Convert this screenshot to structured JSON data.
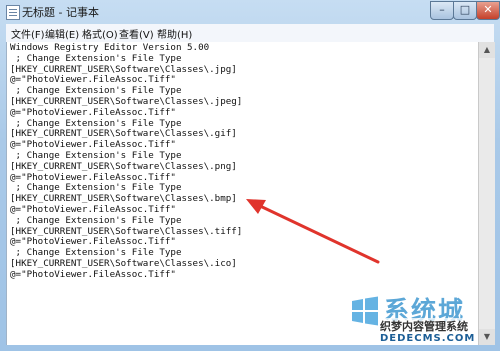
{
  "window": {
    "title": "无标题 - 记事本",
    "controls": {
      "minimize": "–",
      "maximize": "□",
      "close": "✕"
    }
  },
  "menu": [
    "文件(F)",
    "编辑(E)",
    "格式(O)",
    "查看(V)",
    "帮助(H)"
  ],
  "document": {
    "lines": [
      "Windows Registry Editor Version 5.00",
      "; Change Extension's File Type",
      "[HKEY_CURRENT_USER\\Software\\Classes\\.jpg]",
      "@=\"PhotoViewer.FileAssoc.Tiff\"",
      "; Change Extension's File Type",
      "[HKEY_CURRENT_USER\\Software\\Classes\\.jpeg]",
      "@=\"PhotoViewer.FileAssoc.Tiff\"",
      "; Change Extension's File Type",
      "[HKEY_CURRENT_USER\\Software\\Classes\\.gif]",
      "@=\"PhotoViewer.FileAssoc.Tiff\"",
      "; Change Extension's File Type",
      "[HKEY_CURRENT_USER\\Software\\Classes\\.png]",
      "@=\"PhotoViewer.FileAssoc.Tiff\"",
      "; Change Extension's File Type",
      "[HKEY_CURRENT_USER\\Software\\Classes\\.bmp]",
      "@=\"PhotoViewer.FileAssoc.Tiff\"",
      "; Change Extension's File Type",
      "[HKEY_CURRENT_USER\\Software\\Classes\\.tiff]",
      "@=\"PhotoViewer.FileAssoc.Tiff\"",
      "; Change Extension's File Type",
      "[HKEY_CURRENT_USER\\Software\\Classes\\.ico]",
      "@=\"PhotoViewer.FileAssoc.Tiff\""
    ]
  },
  "annotation": {
    "color": "#e0342c"
  },
  "watermark": {
    "brand": "系统城",
    "subtitle": "织梦内容管理系统",
    "url": "DEDECMS.COM"
  }
}
